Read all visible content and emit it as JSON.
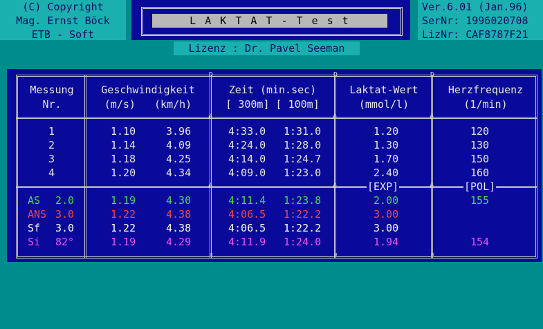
{
  "copyright": {
    "line1": "(C) Copyright",
    "line2": "Mag. Ernst Böck",
    "line3": "ETB - Soft"
  },
  "version": {
    "ver": "Ver.6.01 (Jan.96)",
    "sernr": "SerNr: 1996020708",
    "liznr": "LizNr: CAF8787F21"
  },
  "title": "L A K T A T  -  T e s t",
  "license": "Lizenz : Dr. Pavel Seeman",
  "headers": {
    "col1_line1": "Messung",
    "col1_line2": "Nr.",
    "col2_line1": "Geschwindigkeit",
    "col2_line2": "(m/s)   (km/h)",
    "col3_line1": "Zeit (min.sec)",
    "col3_line2": "[ 300m] [ 100m]",
    "col4_line1": "Laktat-Wert",
    "col4_line2": "(mmol/l)",
    "col5_line1": "Herzfrequenz",
    "col5_line2": "(1/min)"
  },
  "rows": [
    {
      "nr": "1",
      "ms": "1.10",
      "kmh": "3.96",
      "t300": "4:33.0",
      "t100": "1:31.0",
      "laktat": "1.20",
      "hf": "120"
    },
    {
      "nr": "2",
      "ms": "1.14",
      "kmh": "4.09",
      "t300": "4:24.0",
      "t100": "1:28.0",
      "laktat": "1.30",
      "hf": "130"
    },
    {
      "nr": "3",
      "ms": "1.18",
      "kmh": "4.25",
      "t300": "4:14.0",
      "t100": "1:24.7",
      "laktat": "1.70",
      "hf": "150"
    },
    {
      "nr": "4",
      "ms": "1.20",
      "kmh": "4.34",
      "t300": "4:09.0",
      "t100": "1:23.0",
      "laktat": "2.40",
      "hf": "160"
    }
  ],
  "divider_labels": {
    "exp": "[EXP]",
    "pol": "[POL]"
  },
  "results": [
    {
      "label": "AS",
      "val": "2.0",
      "ms": "1.19",
      "kmh": "4.30",
      "t300": "4:11.4",
      "t100": "1:23.8",
      "laktat": "2.00",
      "hf": "155"
    },
    {
      "label": "ANS",
      "val": "3.0",
      "ms": "1.22",
      "kmh": "4.38",
      "t300": "4:06.5",
      "t100": "1:22.2",
      "laktat": "3.00",
      "hf": ""
    },
    {
      "label": "Sf",
      "val": "3.0",
      "ms": "1.22",
      "kmh": "4.38",
      "t300": "4:06.5",
      "t100": "1:22.2",
      "laktat": "3.00",
      "hf": ""
    },
    {
      "label": "Si",
      "val": "82°",
      "ms": "1.19",
      "kmh": "4.29",
      "t300": "4:11.9",
      "t100": "1:24.0",
      "laktat": "1.94",
      "hf": "154"
    }
  ],
  "colors": {
    "background": "#008c8c",
    "panel": "#0a0a9a",
    "as": "#4cd84c",
    "ans": "#f04848",
    "sf": "#ffffff",
    "si": "#f050f0"
  }
}
